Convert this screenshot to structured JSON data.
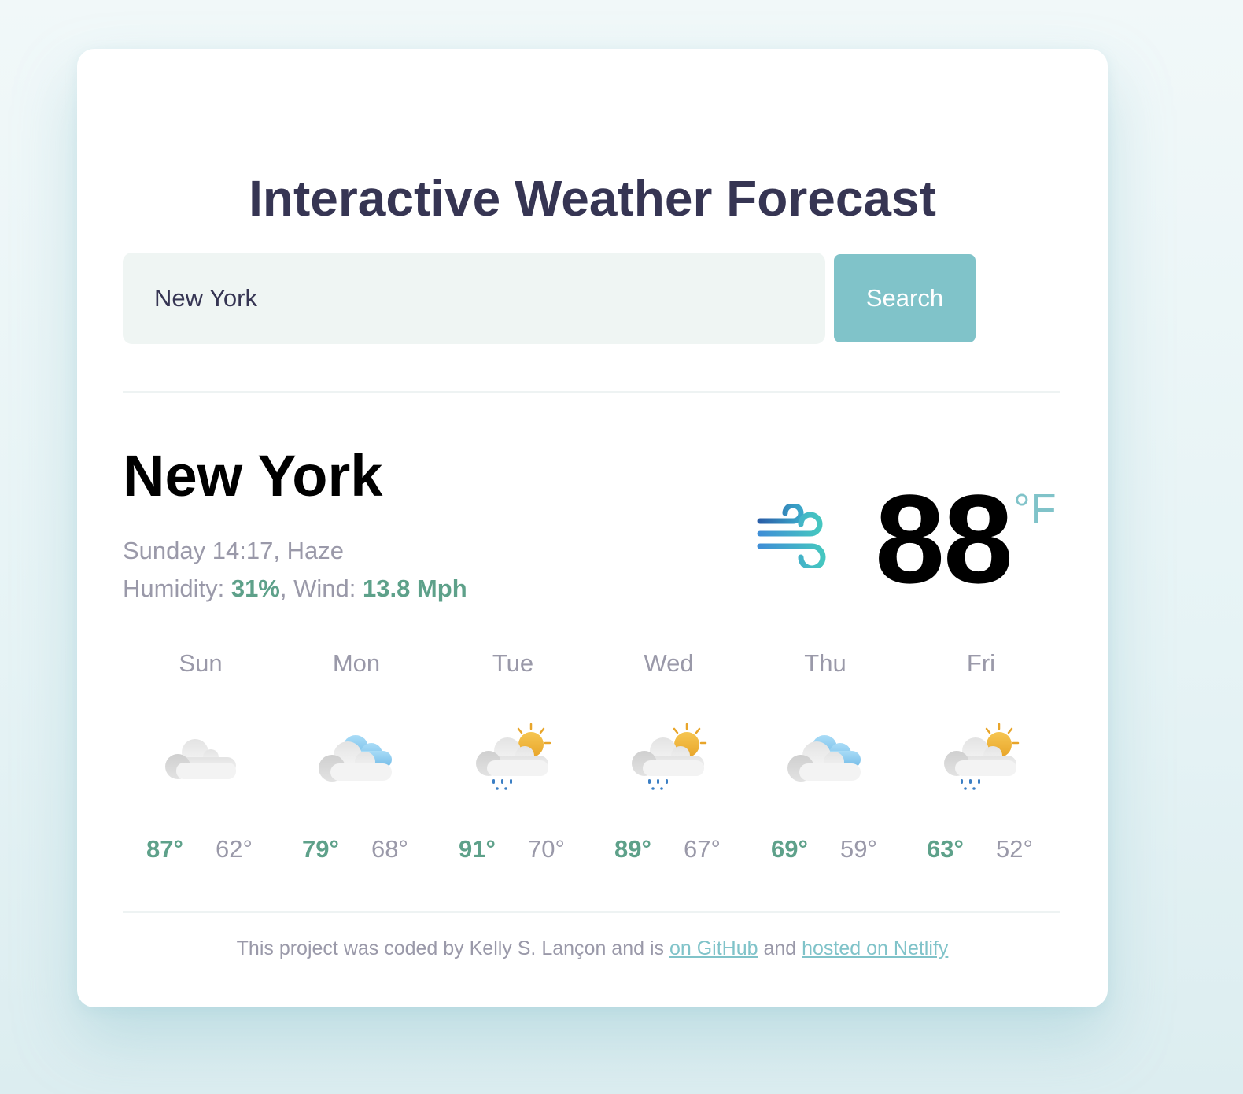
{
  "title": "Interactive Weather Forecast",
  "search": {
    "value": "New York",
    "button_label": "Search"
  },
  "current": {
    "city": "New York",
    "day_time": "Sunday 14:17",
    "condition": "Haze",
    "humidity_label": "Humidity:",
    "humidity": "31%",
    "wind_label": "Wind:",
    "wind": "13.8 Mph",
    "temperature": "88",
    "unit": "°F",
    "icon": "wind-icon"
  },
  "forecast": [
    {
      "day": "Sun",
      "icon": "cloud-icon",
      "high": "87°",
      "low": "62°"
    },
    {
      "day": "Mon",
      "icon": "cloud-blue-icon",
      "high": "79°",
      "low": "68°"
    },
    {
      "day": "Tue",
      "icon": "sun-rain-icon",
      "high": "91°",
      "low": "70°"
    },
    {
      "day": "Wed",
      "icon": "sun-rain-icon",
      "high": "89°",
      "low": "67°"
    },
    {
      "day": "Thu",
      "icon": "cloud-blue-icon",
      "high": "69°",
      "low": "59°"
    },
    {
      "day": "Fri",
      "icon": "sun-rain-icon",
      "high": "63°",
      "low": "52°"
    }
  ],
  "footer": {
    "text_before": "This project was coded by Kelly S. Lançon and is ",
    "github_link": "on GitHub",
    "text_middle": " and ",
    "netlify_link": "hosted on Netlify"
  },
  "colors": {
    "accent": "#80c3c9",
    "highlight_green": "#5ea18a",
    "title": "#363553",
    "muted": "#9a99a9"
  }
}
